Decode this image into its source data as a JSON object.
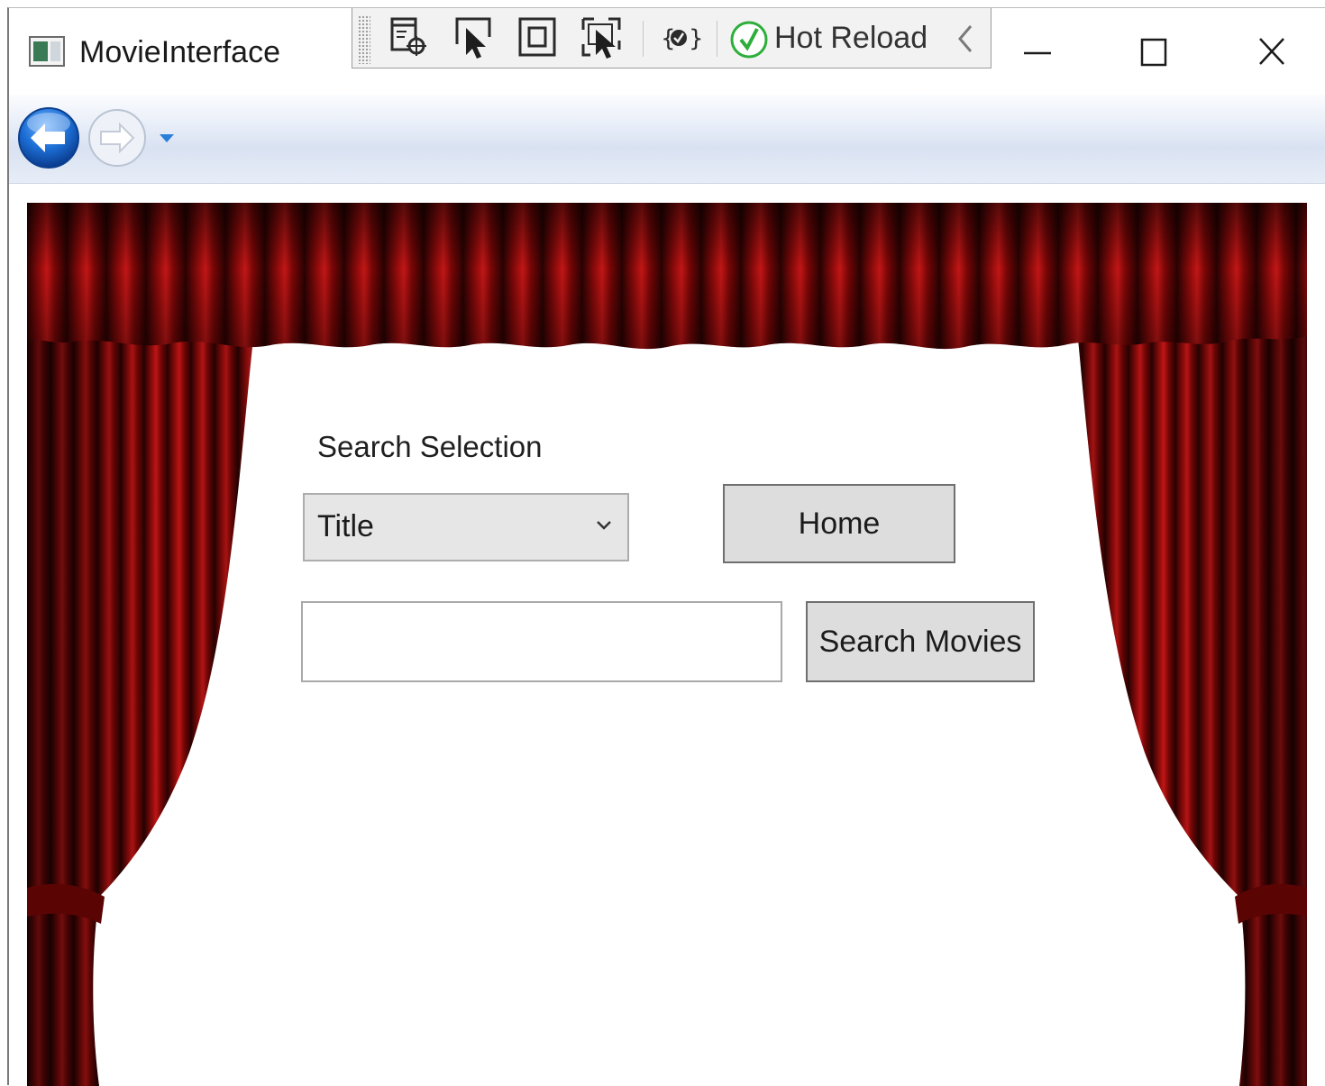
{
  "window": {
    "title": "MovieInterface"
  },
  "dev_toolbar": {
    "hot_reload_label": "Hot Reload",
    "tools": [
      "select-element-icon",
      "display-layout-adorners-icon",
      "track-focus-icon",
      "binding-failures-icon"
    ]
  },
  "navigation": {
    "back_enabled": true,
    "forward_enabled": false
  },
  "search_panel": {
    "label": "Search Selection",
    "selection": {
      "value": "Title"
    },
    "home_button_label": "Home",
    "search_input": {
      "value": "",
      "placeholder": ""
    },
    "search_button_label": "Search Movies"
  },
  "colors": {
    "curtain_red": "#8b0a0a",
    "curtain_dark": "#2a0202",
    "button_face": "#dddddd",
    "hot_reload_green": "#2eae3a",
    "nav_blue": "#1d6fd6"
  }
}
